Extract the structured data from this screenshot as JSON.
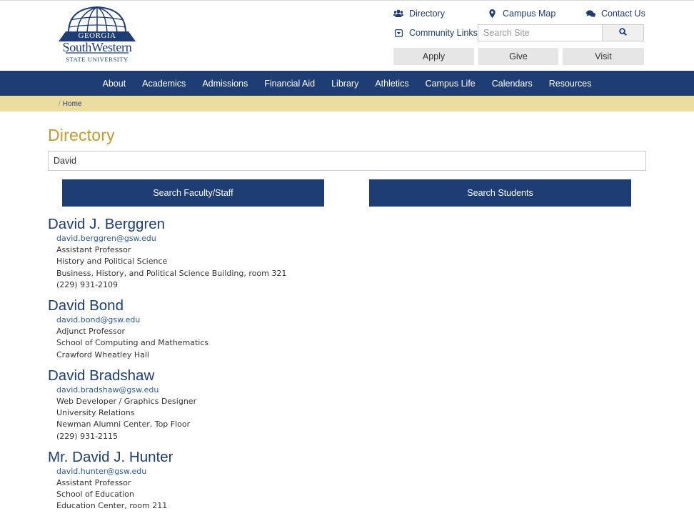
{
  "logo": {
    "line1": "GEORGIA",
    "line2": "SouthWestern",
    "line3": "STATE UNIVERSITY"
  },
  "utility": {
    "directory": "Directory",
    "campus_map": "Campus Map",
    "contact_us": "Contact Us",
    "community_links": "Community Links",
    "search_placeholder": "Search Site"
  },
  "quick_buttons": {
    "apply": "Apply",
    "give": "Give",
    "visit": "Visit"
  },
  "nav": [
    "About",
    "Academics",
    "Admissions",
    "Financial Aid",
    "Library",
    "Athletics",
    "Campus Life",
    "Calendars",
    "Resources"
  ],
  "breadcrumb": {
    "sep": "/",
    "home": "Home"
  },
  "page_title": "Directory",
  "search": {
    "value": "David",
    "faculty_btn": "Search Faculty/Staff",
    "students_btn": "Search Students"
  },
  "results": [
    {
      "name": "David J. Berggren",
      "email": "david.berggren@gsw.edu",
      "lines": [
        "Assistant Professor",
        "History and Political Science",
        "Business, History, and Political Science Building, room 321",
        "(229) 931-2109"
      ]
    },
    {
      "name": "David Bond",
      "email": "david.bond@gsw.edu",
      "lines": [
        "Adjunct Professor",
        "School of Computing and Mathematics",
        "Crawford Wheatley Hall"
      ]
    },
    {
      "name": "David Bradshaw",
      "email": "david.bradshaw@gsw.edu",
      "lines": [
        "Web Developer / Graphics Designer",
        "University Relations",
        "Newman Alumni Center, Top Floor",
        "(229) 931-2115"
      ]
    },
    {
      "name": "Mr. David J. Hunter",
      "email": "david.hunter@gsw.edu",
      "lines": [
        "Assistant Professor",
        "School of Education",
        "Education Center, room 211"
      ]
    }
  ],
  "colors": {
    "navy": "#1e3d74",
    "gold": "#c49a2c",
    "crumb_bg": "#ebdca2"
  }
}
